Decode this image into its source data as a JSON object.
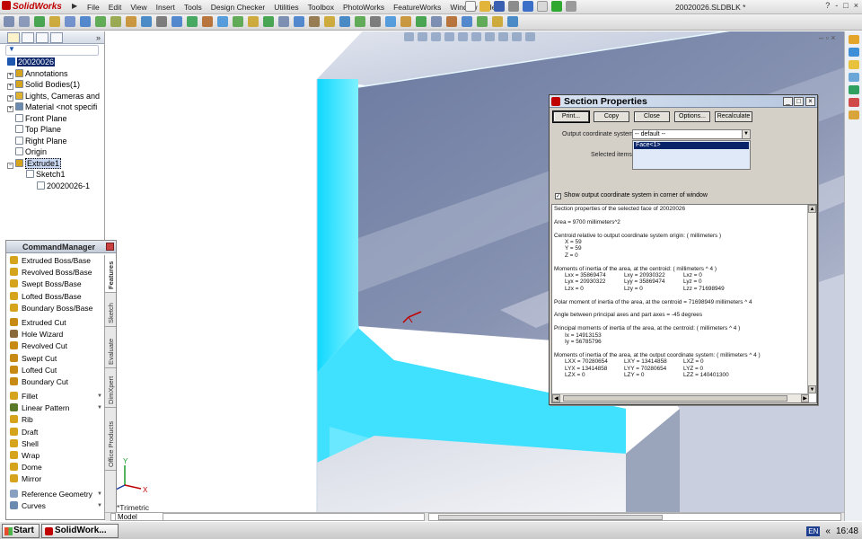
{
  "app": {
    "logo_text": "SolidWorks",
    "menus": [
      "File",
      "Edit",
      "View",
      "Insert",
      "Tools",
      "Design Checker",
      "Utilities",
      "Toolbox",
      "PhotoWorks",
      "FeatureWorks",
      "Window",
      "Help"
    ],
    "document_title": "20020026.SLDBLK *",
    "window_controls": [
      "?",
      "-",
      "□",
      "×"
    ]
  },
  "feature_tree": {
    "root": "20020026",
    "items": [
      {
        "label": "Annotations",
        "icon": "annotations-icon"
      },
      {
        "label": "Solid Bodies(1)",
        "icon": "solid-bodies-icon"
      },
      {
        "label": "Lights, Cameras and",
        "icon": "lights-icon"
      },
      {
        "label": "Material <not specifi",
        "icon": "material-icon"
      },
      {
        "label": "Front Plane",
        "icon": "plane-icon"
      },
      {
        "label": "Top Plane",
        "icon": "plane-icon"
      },
      {
        "label": "Right Plane",
        "icon": "plane-icon"
      },
      {
        "label": "Origin",
        "icon": "origin-icon"
      },
      {
        "label": "Extrude1",
        "icon": "extrude-icon"
      },
      {
        "label": "Sketch1",
        "icon": "sketch-icon"
      },
      {
        "label": "20020026-1",
        "icon": "sketch-block-icon"
      }
    ]
  },
  "command_manager": {
    "title": "CommandManager",
    "items": [
      {
        "label": "Extruded Boss/Base",
        "color": "#d6a31c"
      },
      {
        "label": "Revolved Boss/Base",
        "color": "#d6a31c"
      },
      {
        "label": "Swept Boss/Base",
        "color": "#d6a31c"
      },
      {
        "label": "Lofted Boss/Base",
        "color": "#d6a31c"
      },
      {
        "label": "Boundary Boss/Base",
        "color": "#d6a31c"
      },
      {
        "label": "Extruded Cut",
        "color": "#c78a14"
      },
      {
        "label": "Hole Wizard",
        "color": "#8a6a3a"
      },
      {
        "label": "Revolved Cut",
        "color": "#c78a14"
      },
      {
        "label": "Swept Cut",
        "color": "#c78a14"
      },
      {
        "label": "Lofted Cut",
        "color": "#c78a14"
      },
      {
        "label": "Boundary Cut",
        "color": "#c78a14"
      },
      {
        "label": "Fillet",
        "color": "#d6a31c"
      },
      {
        "label": "Linear Pattern",
        "color": "#5a7a2a"
      },
      {
        "label": "Rib",
        "color": "#d6a31c"
      },
      {
        "label": "Draft",
        "color": "#d6a31c"
      },
      {
        "label": "Shell",
        "color": "#d6a31c"
      },
      {
        "label": "Wrap",
        "color": "#d6a31c"
      },
      {
        "label": "Dome",
        "color": "#d6a31c"
      },
      {
        "label": "Mirror",
        "color": "#d6a31c"
      },
      {
        "label": "Reference Geometry",
        "color": "#8aa0c0"
      },
      {
        "label": "Curves",
        "color": "#6a8ab0"
      }
    ],
    "tabs": [
      "Features",
      "Sketch",
      "Evaluate",
      "DimXpert",
      "Office Products"
    ]
  },
  "graphics": {
    "view_label": "*Trimetric",
    "model_tab": "Model",
    "axis_colors": {
      "x": "#c00000",
      "y": "#2aa02a",
      "z": "#1c3ea8"
    },
    "face_color": "#6f7fa4",
    "edge_color": "#22e6ff"
  },
  "section_properties": {
    "title": "Section Properties",
    "buttons": [
      "Print...",
      "Copy",
      "Close",
      "Options...",
      "Recalculate"
    ],
    "output_cs_label": "Output coordinate system:",
    "output_cs_value": "-- default --",
    "selected_items_label": "Selected items:",
    "selected_item": "Face<1>",
    "show_cs_label": "Show output coordinate system in corner of window",
    "show_cs_checked": true,
    "results": {
      "header": "Section properties of the selected face of 20020026",
      "area": "Area = 9700 millimeters^2",
      "centroid_title": "Centroid relative to output coordinate system origin: ( millimeters )",
      "centroid": [
        "X = 59",
        "Y = 59",
        "Z = 0"
      ],
      "moments_centroid_title": "Moments of inertia of the area, at the centroid: ( millimeters ^ 4 )",
      "moments_centroid": [
        [
          "Lxx = 35869474",
          "Lxy = 20930322",
          "Lxz = 0"
        ],
        [
          "Lyx = 20930322",
          "Lyy = 35869474",
          "Lyz = 0"
        ],
        [
          "Lzx = 0",
          "Lzy = 0",
          "Lzz = 71698949"
        ]
      ],
      "polar": "Polar moment of inertia of the area, at the centroid = 71698949 millimeters ^ 4",
      "angle": "Angle between principal axes and part axes = -45 degrees",
      "principal_title": "Principal moments of inertia of the area, at the centroid: ( millimeters ^ 4 )",
      "principal": [
        "Ix = 14913153",
        "Iy = 56785796"
      ],
      "moments_output_title": "Moments of inertia of the area, at the output coordinate system: ( millimeters ^ 4 )",
      "moments_output": [
        [
          "LXX = 70280654",
          "LXY = 13414858",
          "LXZ = 0"
        ],
        [
          "LYX = 13414858",
          "LYY = 70280654",
          "LYZ = 0"
        ],
        [
          "LZX = 0",
          "LZY = 0",
          "LZZ = 140401300"
        ]
      ]
    }
  },
  "taskbar": {
    "start_label": "Start",
    "task_label": "SolidWork...",
    "language": "EN",
    "tray_arrow": "«",
    "clock": "16:48"
  }
}
